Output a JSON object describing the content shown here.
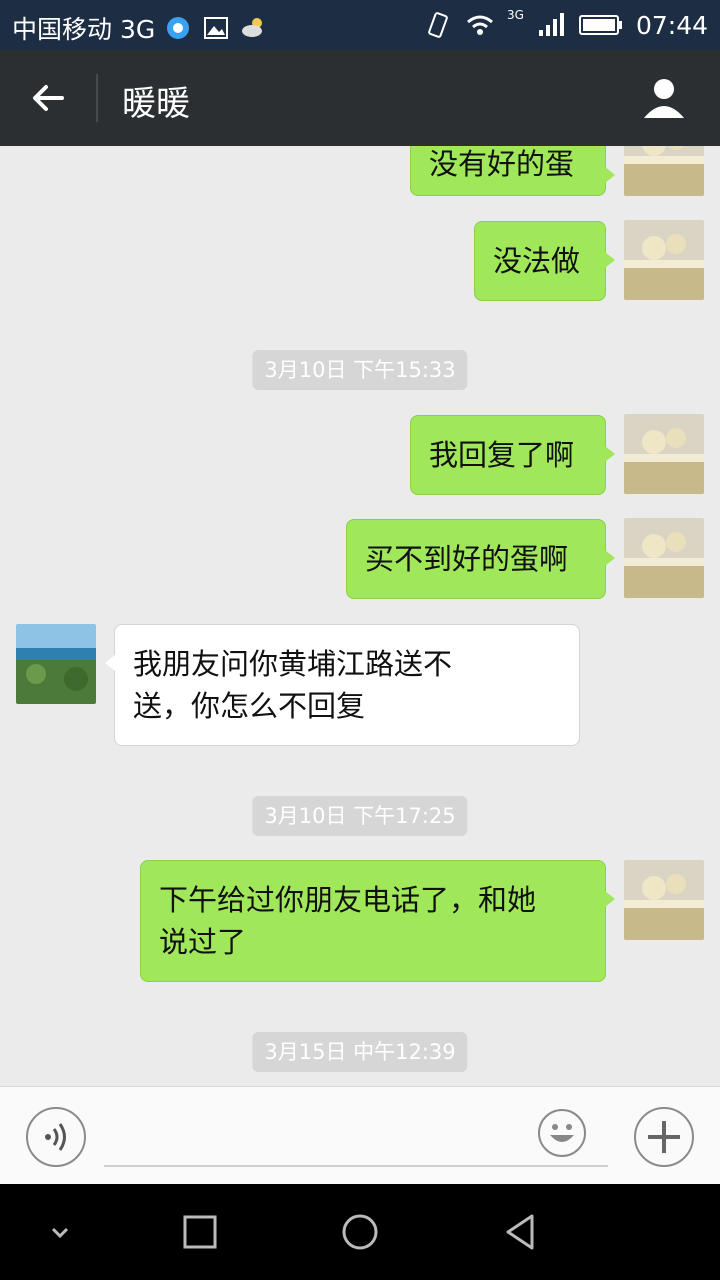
{
  "status": {
    "carrier": "中国移动 3G",
    "network": "3G",
    "time": "07:44"
  },
  "header": {
    "title": "暖暖"
  },
  "messages": {
    "m1": "没有好的蛋",
    "m2": "没法做",
    "ts1": "3月10日 下午15:33",
    "m3": "我回复了啊",
    "m4": "买不到好的蛋啊",
    "m5_line1": "我朋友问你黄埔江路送不",
    "m5_line2": "送，你怎么不回复",
    "ts2": "3月10日 下午17:25",
    "m6_line1": "下午给过你朋友电话了，和她",
    "m6_line2": "说过了",
    "ts3": "3月15日 中午12:39"
  },
  "colors": {
    "bubble_sent": "#a0e75a",
    "bubble_received": "#ffffff",
    "header_bg": "#2b2f32",
    "status_bg": "#1d2d44"
  },
  "icons": [
    "back-arrow-icon",
    "profile-icon",
    "voice-icon",
    "emoji-icon",
    "plus-icon",
    "nav-back-icon",
    "nav-home-icon",
    "nav-recents-icon",
    "nav-down-icon"
  ]
}
